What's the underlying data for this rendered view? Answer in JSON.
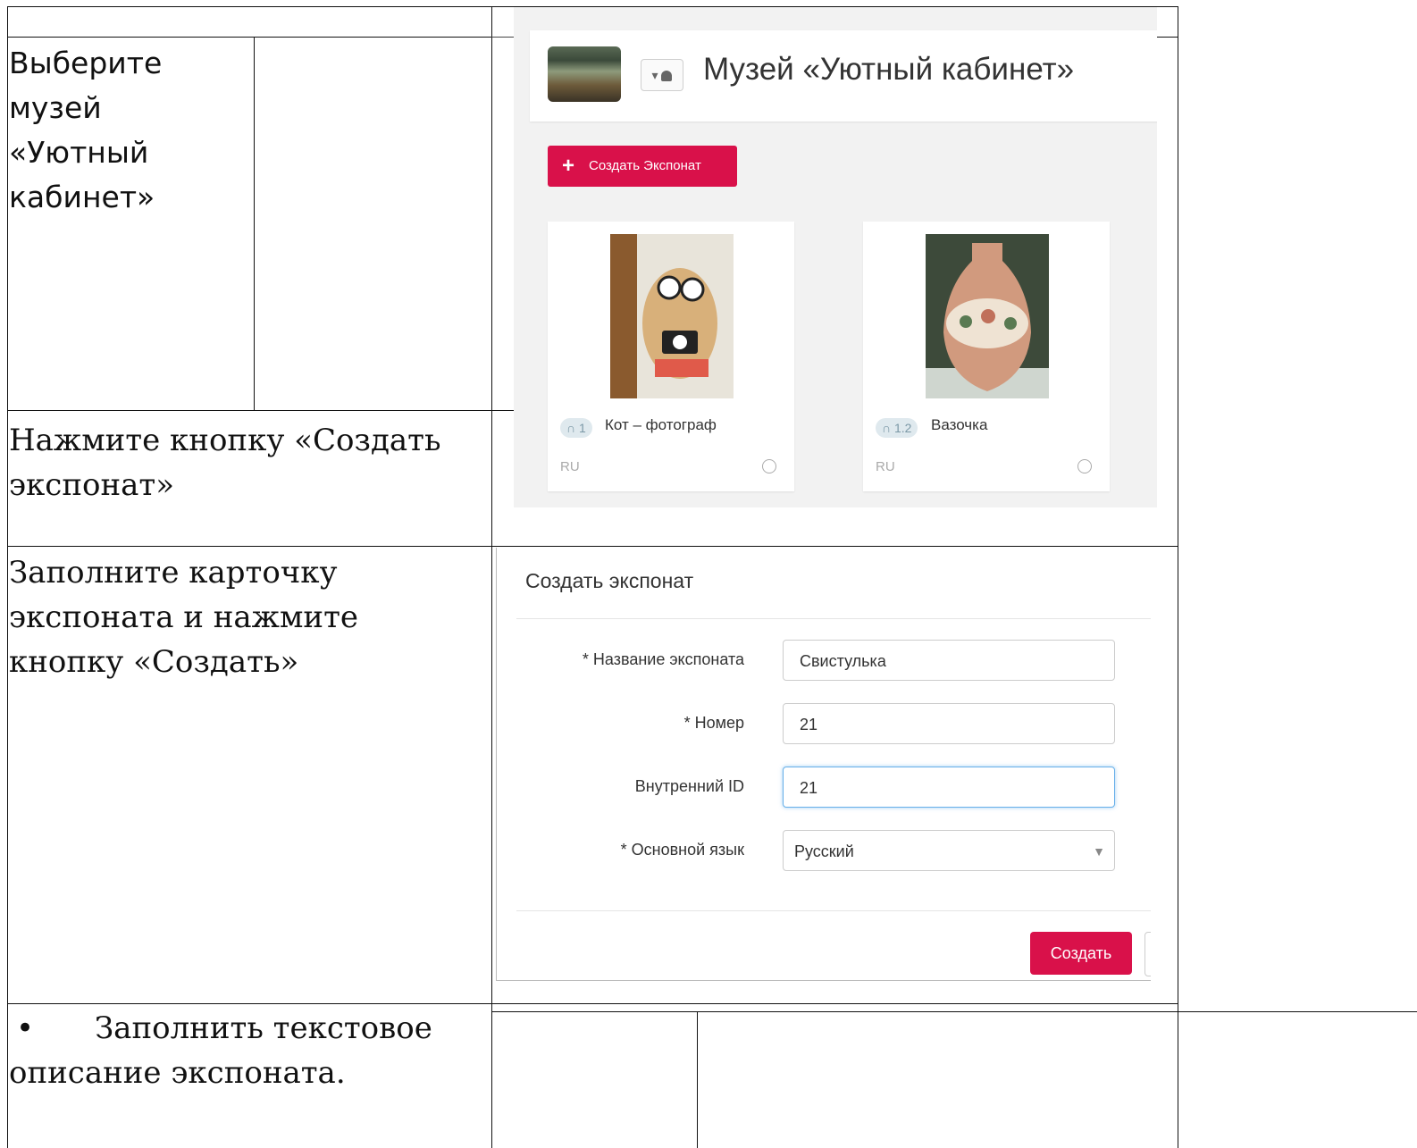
{
  "steps": {
    "step1": "Выберите музей «Уютный кабинет»",
    "step2": "Нажмите кнопку «Создать экспонат»",
    "step3": "Заполните карточку экспоната и нажмите кнопку «Создать»",
    "step4_bullet": "•",
    "step4": "Заполнить текстовое описание экспоната."
  },
  "museum_screen": {
    "title": "Музей «Уютный кабинет»",
    "role_button": "▾ 👤",
    "create_button": "Создать Экспонат",
    "exhibits": [
      {
        "number": "1",
        "title": "Кот – фотограф",
        "lang": "RU"
      },
      {
        "number": "1.2",
        "title": "Вазочка",
        "lang": "RU"
      }
    ]
  },
  "modal": {
    "title": "Создать экспонат",
    "fields": [
      {
        "label": "* Название экспоната",
        "value": "Свистулька"
      },
      {
        "label": "* Номер",
        "value": "21"
      },
      {
        "label": "Внутренний ID",
        "value": "21"
      },
      {
        "label": "* Основной язык",
        "value": "Русский"
      }
    ],
    "submit": "Создать"
  },
  "colors": {
    "accent": "#d9114a",
    "focus": "#66afe9"
  },
  "icons": [
    "plus-icon",
    "user-icon",
    "caret-down-icon",
    "headphones-icon",
    "globe-icon"
  ]
}
